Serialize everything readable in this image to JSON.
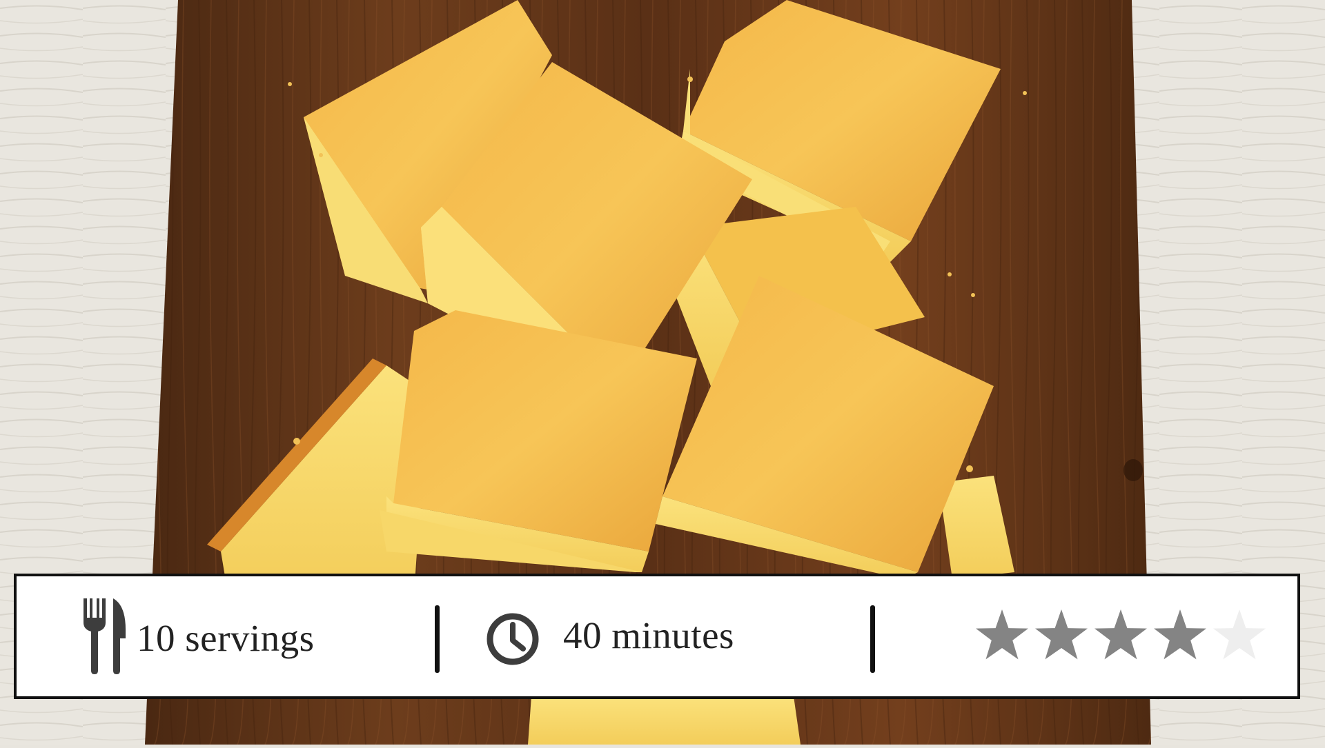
{
  "recipe": {
    "servings_label": "10 servings",
    "time_label": "40 minutes",
    "rating": 4,
    "rating_max": 5
  },
  "icons": {
    "servings": "fork-knife-icon",
    "time": "clock-icon",
    "rating": "star-icon"
  },
  "colors": {
    "bar_background": "#ffffff",
    "bar_border": "#111111",
    "icon": "#3d3d3d",
    "star_filled": "#848484",
    "star_empty": "#eeeeee"
  }
}
